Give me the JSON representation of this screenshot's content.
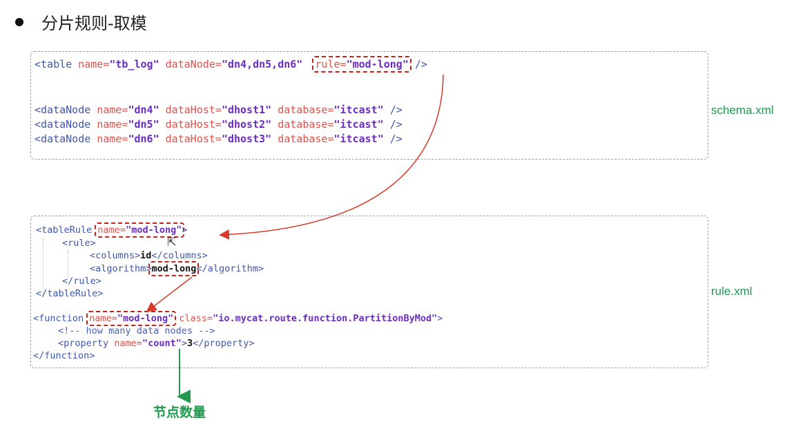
{
  "title": "分片规则-取模",
  "schema_label": "schema.xml",
  "rule_label": "rule.xml",
  "count_label": "节点数量",
  "schema": {
    "table": {
      "open": "<table",
      "name_attr": "name=",
      "name_val": "\"tb_log\"",
      "node_attr": "dataNode=",
      "node_val": "\"dn4,dn5,dn6\"",
      "rule_attr": "rule=",
      "rule_val": "\"mod-long\"",
      "close": " />"
    },
    "datanodes": [
      {
        "open": "<dataNode",
        "name_attr": "name=",
        "name_val": "\"dn4\"",
        "host_attr": "dataHost=",
        "host_val": "\"dhost1\"",
        "db_attr": "database=",
        "db_val": "\"itcast\"",
        "close": " />"
      },
      {
        "open": "<dataNode",
        "name_attr": "name=",
        "name_val": "\"dn5\"",
        "host_attr": "dataHost=",
        "host_val": "\"dhost2\"",
        "db_attr": "database=",
        "db_val": "\"itcast\"",
        "close": " />"
      },
      {
        "open": "<dataNode",
        "name_attr": "name=",
        "name_val": "\"dn6\"",
        "host_attr": "dataHost=",
        "host_val": "\"dhost3\"",
        "db_attr": "database=",
        "db_val": "\"itcast\"",
        "close": " />"
      }
    ]
  },
  "rule": {
    "tablerule_open": "<tableRule",
    "tablerule_name_attr": "name=",
    "tablerule_name_val": "\"mod-long\"",
    "tablerule_end": ">",
    "rule_open": "<rule>",
    "columns_open": "<columns>",
    "columns_val": "id",
    "columns_close": "</columns>",
    "algorithm_open": "<algorithm>",
    "algorithm_val": "mod-long",
    "algorithm_close": "</algorithm>",
    "rule_close": "</rule>",
    "tablerule_close": "</tableRule>",
    "function_open": "<function",
    "function_name_attr": "name=",
    "function_name_val": "\"mod-long\"",
    "function_class_attr": "class=",
    "function_class_val": "\"io.mycat.route.function.PartitionByMod\"",
    "function_end": ">",
    "comment": "<!-- how many data nodes -->",
    "property_open": "<property",
    "property_name_attr": "name=",
    "property_name_val": "\"count\"",
    "property_gt": ">",
    "property_val": "3",
    "property_close": "</property>",
    "function_close": "</function>"
  }
}
